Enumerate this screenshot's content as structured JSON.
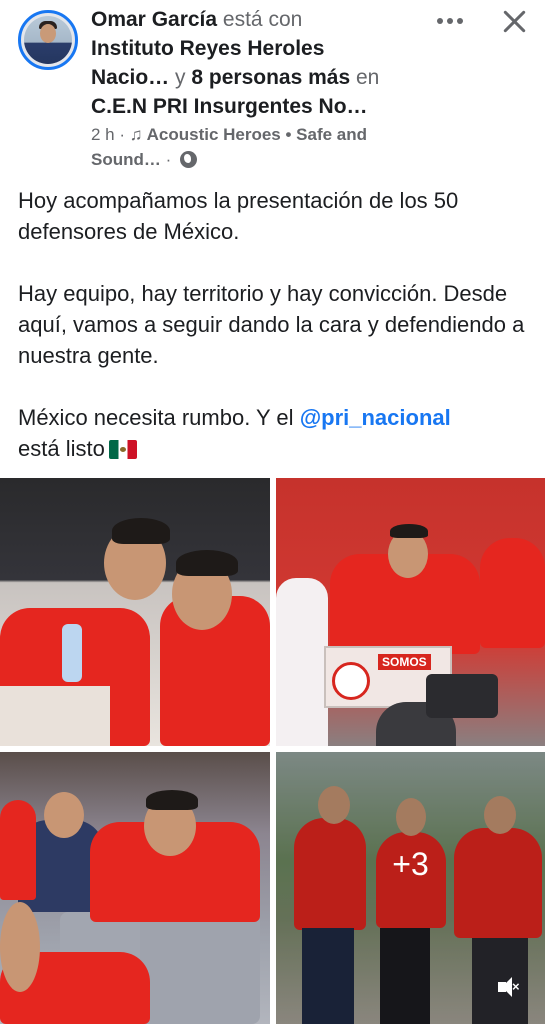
{
  "post": {
    "author": "Omar García",
    "with_text": "está con",
    "tagged_primary": "Instituto Reyes Heroles",
    "tagged_primary_cont": "Nacio…",
    "and_text": "y",
    "others": "8 personas más",
    "in_text": "en",
    "location": "C.E.N PRI Insurgentes No…",
    "time": "2 h",
    "music_icon": "music-note-icon",
    "song": "Acoustic Heroes • Safe and",
    "song_cont": "Sound…",
    "privacy_icon": "globe-icon"
  },
  "body": {
    "para1": "Hoy acompañamos la presentación de los 50 defensores de México.",
    "para2": "Hay equipo, hay territorio y hay convicción. Desde aquí, vamos a seguir dando la cara y defendiendo a nuestra gente.",
    "para3_start": "México necesita rumbo. Y el",
    "mention": "@pri_nacional",
    "para3_end": "está listo",
    "flag_icon": "mexico-flag-icon"
  },
  "media": {
    "more_count": "+3",
    "podium_text": "SOMOS",
    "mute_icon": "speaker-muted-icon"
  },
  "colors": {
    "link": "#1877f2",
    "muted": "#65676b",
    "jacket_red": "#e5261f"
  }
}
